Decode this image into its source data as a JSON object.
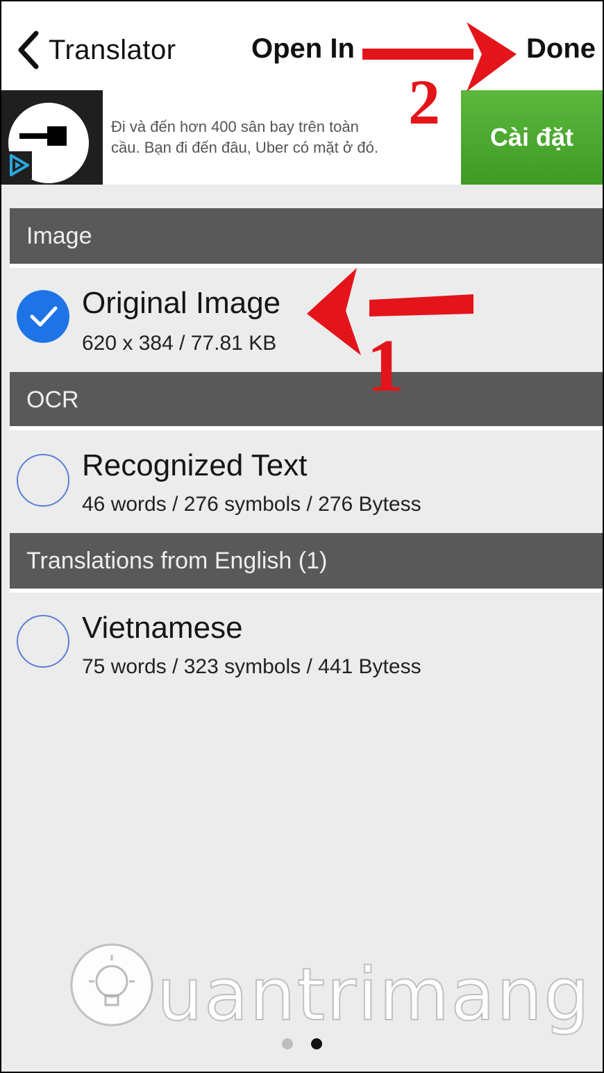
{
  "nav": {
    "back_label": "Translator",
    "title": "Open In",
    "done_label": "Done"
  },
  "ad": {
    "text_line1": "Đi và đến hơn 400 sân bay trên toàn",
    "text_line2": "cầu. Bạn đi đến đâu, Uber có mặt ở đó.",
    "button_label": "Cài đặt",
    "button_color": "#4caa30"
  },
  "sections": [
    {
      "header": "Image"
    },
    {
      "header": "OCR"
    },
    {
      "header": "Translations from English (1)"
    }
  ],
  "items": [
    {
      "title": "Original Image",
      "subtitle": "620 x 384 / 77.81 KB",
      "selected": true
    },
    {
      "title": "Recognized Text",
      "subtitle": "46 words / 276 symbols / 276 Bytess",
      "selected": false
    },
    {
      "title": "Vietnamese",
      "subtitle": "75 words / 323 symbols / 441 Bytess",
      "selected": false
    }
  ],
  "annotations": {
    "step1": "1",
    "step2": "2",
    "arrow_color": "#e4141b"
  },
  "watermark": "uantrimang",
  "page_indicator": {
    "count": 2,
    "active": 2
  },
  "colors": {
    "accent": "#1e74e6",
    "section_header": "#595959",
    "background": "#ececec"
  }
}
